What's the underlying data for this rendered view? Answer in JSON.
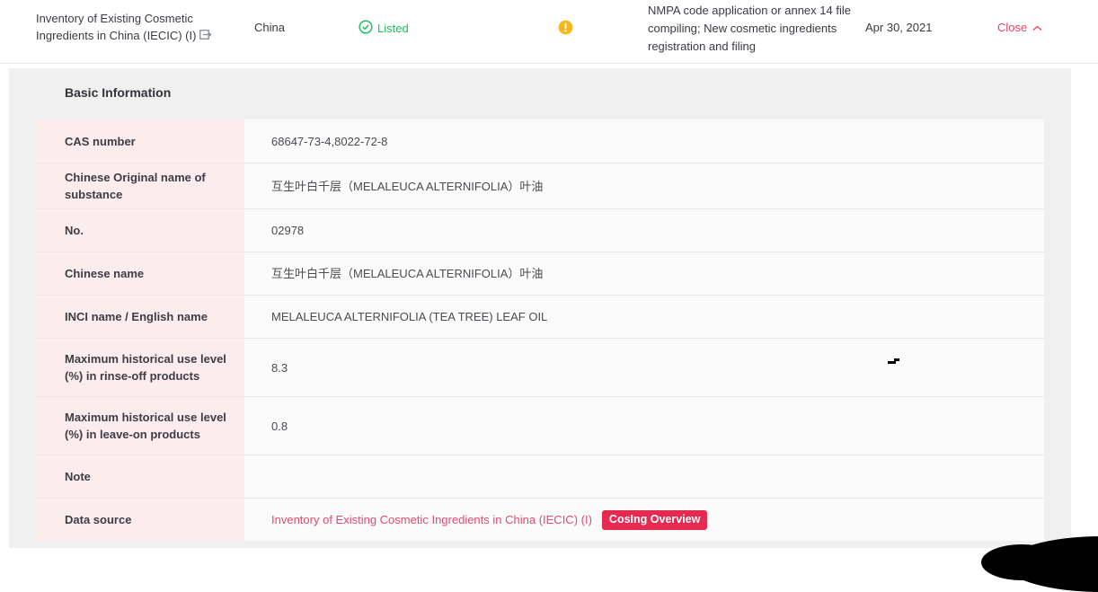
{
  "header": {
    "inventory_title": "Inventory of Existing Cosmetic Ingredients in China (IECIC) (I)",
    "region": "China",
    "status_label": "Listed",
    "usage_text": "NMPA code application or annex 14 file compiling; New cosmetic ingredients registration and filing",
    "date": "Apr 30, 2021",
    "close_label": "Close"
  },
  "panel": {
    "title": "Basic Information",
    "rows": [
      {
        "label": "CAS number",
        "value": "68647-73-4,8022-72-8"
      },
      {
        "label": "Chinese Original name of substance",
        "value": "互生叶白千层（MELALEUCA ALTERNIFOLIA）叶油"
      },
      {
        "label": "No.",
        "value": "02978"
      },
      {
        "label": "Chinese name",
        "value": "互生叶白千层（MELALEUCA ALTERNIFOLIA）叶油"
      },
      {
        "label": "INCI name / English name",
        "value": "MELALEUCA ALTERNIFOLIA (TEA TREE) LEAF OIL"
      },
      {
        "label": "Maximum historical use level (%) in rinse-off products",
        "value": "8.3"
      },
      {
        "label": "Maximum historical use level (%) in leave-on products",
        "value": "0.8"
      },
      {
        "label": "Note",
        "value": ""
      },
      {
        "label": "Data source",
        "value": ""
      }
    ],
    "data_source": {
      "link_text": "Inventory of Existing Cosmetic Ingredients in China (IECIC) (I)",
      "badge_label": "CosIng Overview"
    }
  },
  "colors": {
    "status_green": "#1fc05c",
    "warning_amber": "#f7b71d",
    "accent_pink": "#e8486b",
    "close_pink": "#ee4165",
    "badge_red": "#e52a52",
    "label_cell_pink": "#fcecee",
    "panel_gray": "#f0f0f0"
  }
}
